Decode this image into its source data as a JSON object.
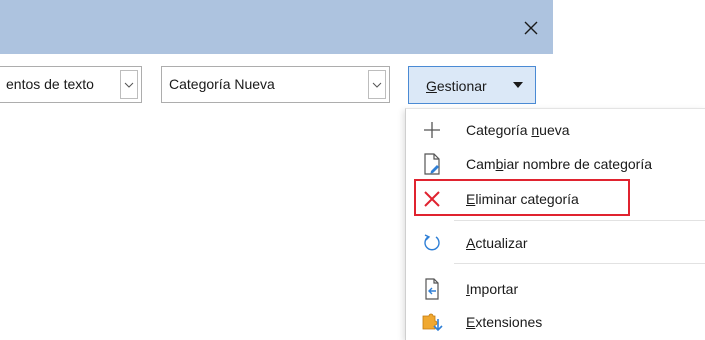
{
  "dialog": {
    "close_icon": "close-icon"
  },
  "toolbar": {
    "filter_combo": {
      "value": "entos de texto"
    },
    "category_combo": {
      "value": "Categoría Nueva"
    },
    "manage_button": {
      "label_pre": "",
      "label_mnemonic": "G",
      "label_post": "estionar"
    }
  },
  "menu": {
    "items": [
      {
        "icon": "plus-icon",
        "pre": "Categoría ",
        "mn": "n",
        "post": "ueva"
      },
      {
        "icon": "rename-document-icon",
        "pre": "Cam",
        "mn": "b",
        "post": "iar nombre de categoría"
      },
      {
        "icon": "delete-x-icon",
        "pre": "",
        "mn": "E",
        "post": "liminar categoría"
      },
      {
        "icon": "refresh-icon",
        "pre": "",
        "mn": "A",
        "post": "ctualizar"
      },
      {
        "icon": "import-icon",
        "pre": "",
        "mn": "I",
        "post": "mportar"
      },
      {
        "icon": "extensions-icon",
        "pre": "",
        "mn": "E",
        "post": "xtensiones"
      }
    ]
  },
  "colors": {
    "titlebar": "#adc3df",
    "accent_border": "#4a8ad4",
    "highlight_red": "#e0232f",
    "delete_red": "#e0232f",
    "refresh_blue": "#2f7fd6"
  }
}
